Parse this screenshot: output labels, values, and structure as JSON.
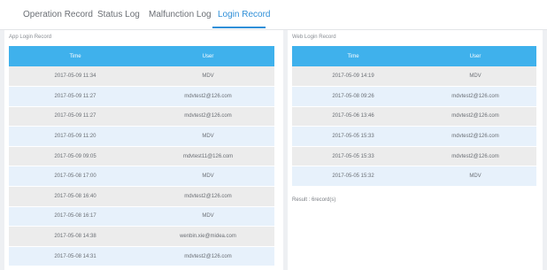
{
  "tabs": [
    {
      "label": "Operation Record"
    },
    {
      "label": "Status Log"
    },
    {
      "label": "Malfunction Log"
    },
    {
      "label": "Login Record"
    }
  ],
  "app_login": {
    "title": "App Login Record",
    "headers": [
      "Time",
      "User"
    ],
    "rows": [
      [
        "2017-05-09 11:34",
        "MDV"
      ],
      [
        "2017-05-09 11:27",
        "mdvtest2@126.com"
      ],
      [
        "2017-05-09 11:27",
        "mdvtest2@126.com"
      ],
      [
        "2017-05-09 11:20",
        "MDV"
      ],
      [
        "2017-05-09 09:05",
        "mdvtest11@126.com"
      ],
      [
        "2017-05-08 17:00",
        "MDV"
      ],
      [
        "2017-05-08 16:40",
        "mdvtest2@126.com"
      ],
      [
        "2017-05-08 16:17",
        "MDV"
      ],
      [
        "2017-05-08 14:38",
        "wenbin.xie@midea.com"
      ],
      [
        "2017-05-08 14:31",
        "mdvtest2@126.com"
      ]
    ]
  },
  "web_login": {
    "title": "Web Login Record",
    "headers": [
      "Time",
      "User"
    ],
    "rows": [
      [
        "2017-05-09 14:19",
        "MDV"
      ],
      [
        "2017-05-08 09:26",
        "mdvtest2@126.com"
      ],
      [
        "2017-05-06 13:46",
        "mdvtest2@126.com"
      ],
      [
        "2017-05-05 15:33",
        "mdvtest2@126.com"
      ],
      [
        "2017-05-05 15:33",
        "mdvtest2@126.com"
      ],
      [
        "2017-05-05 15:32",
        "MDV"
      ]
    ],
    "result": "Result : 6record(s)"
  },
  "colors": {
    "accent": "#2f8fd8",
    "table_header": "#3fb1ec",
    "row_odd": "#ececec",
    "row_even": "#e7f1fb"
  }
}
